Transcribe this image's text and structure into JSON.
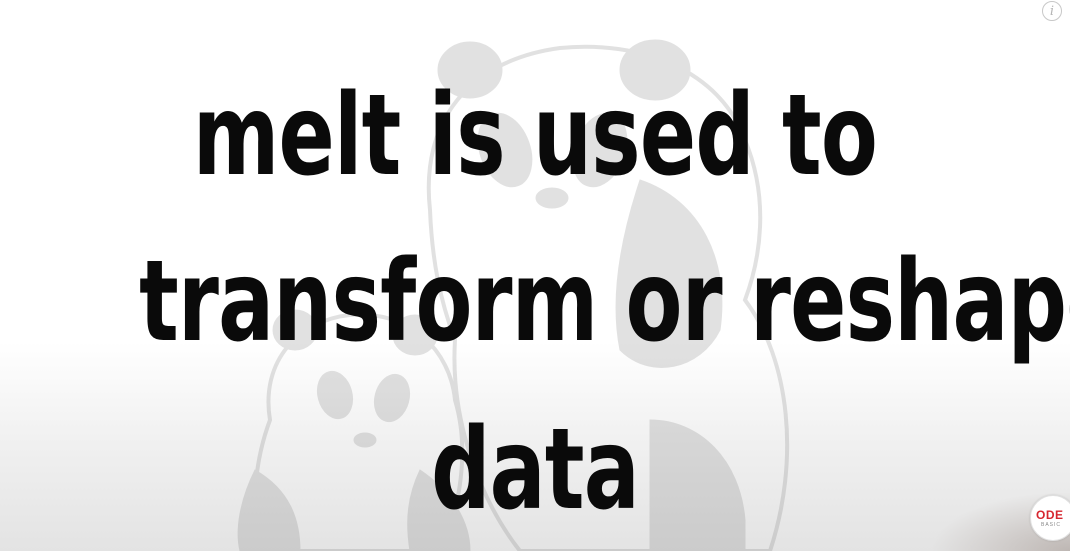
{
  "slide": {
    "lines": [
      "melt is used to",
      "transform or reshape",
      "data"
    ]
  },
  "overlay": {
    "info_glyph": "i"
  },
  "logo": {
    "text_main": "ODE",
    "text_sub": "BASIC"
  },
  "colors": {
    "text": "#0a0a0a",
    "watermark": "#d4d4d4",
    "logo_accent": "#d6262f"
  },
  "icons": {
    "info": "info-icon",
    "watermark": "panda-illustration",
    "logo": "codebasics-logo"
  }
}
